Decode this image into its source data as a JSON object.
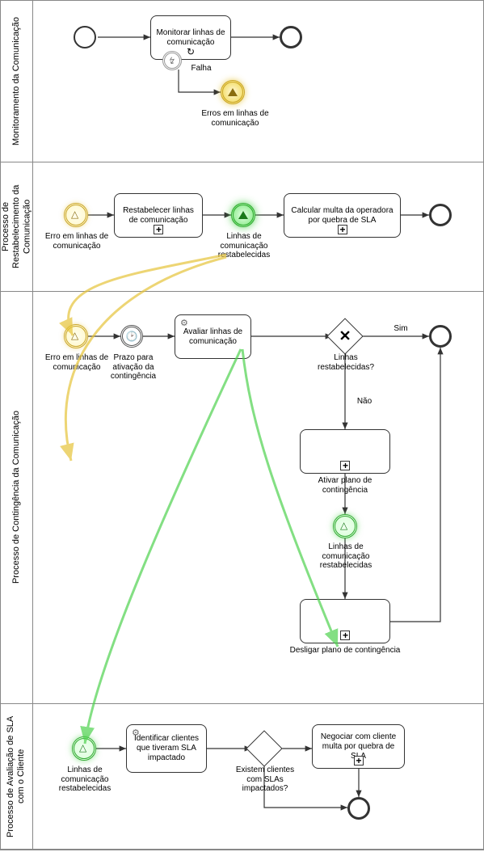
{
  "lanes": {
    "l1": "Monitoramento da Comunicação",
    "l2": "Processo de Restabelecimento da Comunicação",
    "l3": "Processo de Contingência da Comunicação",
    "l4": "Processo de Avaliação de SLA com o Cliente"
  },
  "l1": {
    "task_monitor": "Monitorar linhas de comunicação",
    "boundary_label": "Falha",
    "signal_throw": "Erros em linhas de comunicação"
  },
  "l2": {
    "start_signal": "Erro em linhas de comunicação",
    "task_restab": "Restabelecer linhas de comunicação",
    "mid_signal": "Linhas de comunicação restabelecidas",
    "task_calc": "Calcular multa da operadora por quebra de SLA"
  },
  "l3": {
    "start_signal": "Erro em linhas de comunicação",
    "timer": "Prazo para ativação da contingência",
    "task_avaliar": "Avaliar linhas de comunicação",
    "gateway1": "Linhas restabelecidas?",
    "gw_yes": "Sim",
    "gw_no": "Não",
    "task_ativar": "Ativar plano de contingência",
    "mid_signal": "Linhas de comunicação restabelecidas",
    "task_desligar": "Desligar plano de contingência"
  },
  "l4": {
    "start_signal": "Linhas de comunicação restabelecidas",
    "task_ident": "Identificar clientes que tiveram SLA impactado",
    "gateway": "Existem clientes com SLAs impactados?",
    "task_negociar": "Negociar com cliente multa por quebra de SLA"
  },
  "colors": {
    "signal_yellow": "#e6c43a",
    "signal_green": "#4fd24f"
  },
  "chart_data": {
    "type": "bpmn-diagram",
    "pools": [
      {
        "name": "Monitoramento da Comunicação",
        "elements": [
          {
            "id": "s1",
            "type": "start-event"
          },
          {
            "id": "t1",
            "type": "task-loop",
            "label": "Monitorar linhas de comunicação"
          },
          {
            "id": "b1",
            "type": "boundary-error",
            "attached_to": "t1",
            "label": "Falha"
          },
          {
            "id": "e1",
            "type": "end-event"
          },
          {
            "id": "sig1",
            "type": "signal-throw",
            "label": "Erros em linhas de comunicação"
          }
        ],
        "flows": [
          [
            "s1",
            "t1"
          ],
          [
            "t1",
            "e1"
          ],
          [
            "b1",
            "sig1"
          ]
        ]
      },
      {
        "name": "Processo de Restabelecimento da Comunicação",
        "elements": [
          {
            "id": "sc2",
            "type": "signal-catch",
            "label": "Erro em linhas de comunicação"
          },
          {
            "id": "t2",
            "type": "subprocess",
            "label": "Restabelecer linhas de comunicação"
          },
          {
            "id": "sig2",
            "type": "signal-throw-intermediate",
            "label": "Linhas de comunicação restabelecidas"
          },
          {
            "id": "t3",
            "type": "subprocess",
            "label": "Calcular multa da operadora por quebra de SLA"
          },
          {
            "id": "e2",
            "type": "end-event"
          }
        ],
        "flows": [
          [
            "sc2",
            "t2"
          ],
          [
            "t2",
            "sig2"
          ],
          [
            "sig2",
            "t3"
          ],
          [
            "t3",
            "e2"
          ]
        ]
      },
      {
        "name": "Processo de Contingência da Comunicação",
        "elements": [
          {
            "id": "sc3",
            "type": "signal-catch",
            "label": "Erro em linhas de comunicação"
          },
          {
            "id": "tm1",
            "type": "timer-intermediate",
            "label": "Prazo para ativação da contingência"
          },
          {
            "id": "t4",
            "type": "service-task",
            "label": "Avaliar linhas de comunicação"
          },
          {
            "id": "g1",
            "type": "exclusive-gateway",
            "label": "Linhas restabelecidas?",
            "outgoing": [
              "Sim",
              "Não"
            ]
          },
          {
            "id": "t5",
            "type": "subprocess",
            "label": "Ativar plano de contingência"
          },
          {
            "id": "sc3b",
            "type": "signal-catch-intermediate",
            "label": "Linhas de comunicação restabelecidas"
          },
          {
            "id": "t6",
            "type": "subprocess",
            "label": "Desligar plano de contingência"
          },
          {
            "id": "e3",
            "type": "end-event"
          }
        ],
        "flows": [
          [
            "sc3",
            "tm1"
          ],
          [
            "tm1",
            "t4"
          ],
          [
            "t4",
            "g1"
          ],
          [
            "g1",
            "e3",
            "Sim"
          ],
          [
            "g1",
            "t5",
            "Não"
          ],
          [
            "t5",
            "sc3b"
          ],
          [
            "sc3b",
            "t6"
          ],
          [
            "t6",
            "e3"
          ]
        ]
      },
      {
        "name": "Processo de Avaliação de SLA com o Cliente",
        "elements": [
          {
            "id": "sc4",
            "type": "signal-catch",
            "label": "Linhas de comunicação restabelecidas"
          },
          {
            "id": "t7",
            "type": "service-task",
            "label": "Identificar clientes que tiveram SLA impactado"
          },
          {
            "id": "g2",
            "type": "exclusive-gateway",
            "label": "Existem clientes com SLAs impactados?"
          },
          {
            "id": "t8",
            "type": "subprocess",
            "label": "Negociar com cliente multa por quebra de SLA"
          },
          {
            "id": "e4",
            "type": "end-event"
          }
        ],
        "flows": [
          [
            "sc4",
            "t7"
          ],
          [
            "t7",
            "g2"
          ],
          [
            "g2",
            "t8"
          ],
          [
            "t8",
            "e4"
          ],
          [
            "g2",
            "e4"
          ]
        ]
      }
    ],
    "signal_links": [
      {
        "from": "sig1",
        "to": [
          "sc2",
          "sc3"
        ],
        "color": "yellow"
      },
      {
        "from": "sig2",
        "to": [
          "sc3b",
          "sc4"
        ],
        "color": "green"
      }
    ]
  }
}
